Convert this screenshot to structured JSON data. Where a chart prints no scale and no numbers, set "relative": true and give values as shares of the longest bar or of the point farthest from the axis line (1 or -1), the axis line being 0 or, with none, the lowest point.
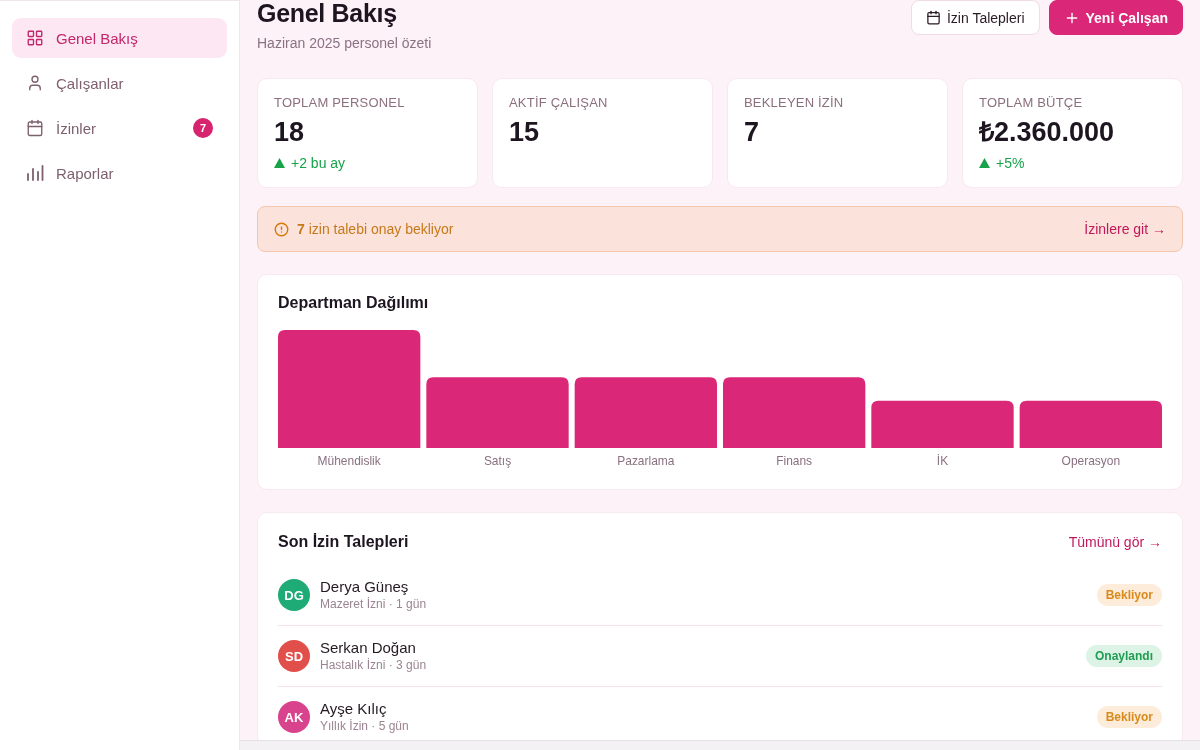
{
  "sidebar": {
    "items": [
      {
        "label": "Genel Bakış",
        "selected": true
      },
      {
        "label": "Çalışanlar",
        "selected": false
      },
      {
        "label": "İzinler",
        "selected": false,
        "badge": "7"
      },
      {
        "label": "Raporlar",
        "selected": false
      }
    ]
  },
  "header": {
    "title": "Genel Bakış",
    "subtitle": "Haziran 2025 personel özeti",
    "buttons": [
      {
        "label": "İzin Talepleri",
        "kind": "secondary"
      },
      {
        "label": "Yeni Çalışan",
        "kind": "primary"
      }
    ]
  },
  "stats": [
    {
      "label": "TOPLAM PERSONEL",
      "value": "18",
      "trend": "+2 bu ay"
    },
    {
      "label": "AKTİF ÇALIŞAN",
      "value": "15"
    },
    {
      "label": "BEKLEYEN İZİN",
      "value": "7"
    },
    {
      "label": "TOPLAM BÜTÇE",
      "value": "₺2.360.000",
      "trend": "+5%"
    }
  ],
  "alert": {
    "message": "**7** izin talebi onay bekliyor",
    "link": "İzinlere git →"
  },
  "department_chart": {
    "title": "Departman Dağılımı",
    "chart_data": {
      "type": "bar",
      "relative": true,
      "categories": [
        "Mühendislik",
        "Satış",
        "Pazarlama",
        "Finans",
        "İK",
        "Operasyon"
      ],
      "values": [
        1,
        0.6,
        0.6,
        0.6,
        0.4,
        0.4
      ]
    }
  },
  "recent_requests": {
    "title": "Son İzin Talepleri",
    "link": "Tümünü gör →",
    "rows": [
      {
        "initials": "DG",
        "color": "#1eab76",
        "name": "Derya Güneş",
        "detail": "Mazeret İzni · 1 gün",
        "status": "Bekliyor",
        "kind": "pending"
      },
      {
        "initials": "SD",
        "color": "#e14f4b",
        "name": "Serkan Doğan",
        "detail": "Hastalık İzni · 3 gün",
        "status": "Onaylandı",
        "kind": "approved"
      },
      {
        "initials": "AK",
        "color": "#d9428c",
        "name": "Ayşe Kılıç",
        "detail": "Yıllık İzin · 5 gün",
        "status": "Bekliyor",
        "kind": "pending"
      }
    ]
  }
}
